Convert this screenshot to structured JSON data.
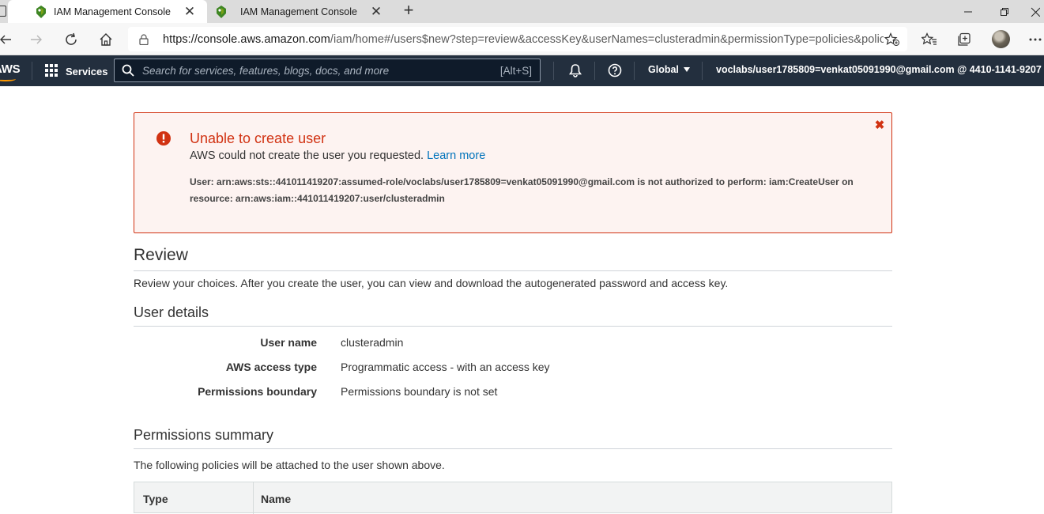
{
  "browser": {
    "tabs": [
      {
        "title": "IAM Management Console",
        "active": true
      },
      {
        "title": "IAM Management Console",
        "active": false
      }
    ],
    "url_host": "https://console.aws.amazon.com",
    "url_path": "/iam/home#/users$new?step=review&accessKey&userNames=clusteradmin&permissionType=policies&policie..."
  },
  "aws_nav": {
    "logo": "AWS",
    "services_label": "Services",
    "search_placeholder": "Search for services, features, blogs, docs, and more",
    "search_shortcut": "[Alt+S]",
    "region": "Global",
    "account": "voclabs/user1785809=venkat05091990@gmail.com @ 4410-1141-9207"
  },
  "error": {
    "title": "Unable to create user",
    "description": "AWS could not create the user you requested.",
    "learn_more": "Learn more",
    "detail_line1": "User: arn:aws:sts::441011419207:assumed-role/voclabs/user1785809=venkat05091990@gmail.com is not authorized to perform: iam:CreateUser on",
    "detail_line2": "resource: arn:aws:iam::441011419207:user/clusteradmin",
    "colors": {
      "border": "#d13212",
      "background": "#fdf3f1"
    }
  },
  "review": {
    "heading": "Review",
    "intro": "Review your choices. After you create the user, you can view and download the autogenerated password and access key.",
    "user_details_heading": "User details",
    "details": [
      {
        "label": "User name",
        "value": "clusteradmin"
      },
      {
        "label": "AWS access type",
        "value": "Programmatic access - with an access key"
      },
      {
        "label": "Permissions boundary",
        "value": "Permissions boundary is not set"
      }
    ],
    "permissions_heading": "Permissions summary",
    "permissions_intro": "The following policies will be attached to the user shown above.",
    "table_headers": {
      "type": "Type",
      "name": "Name"
    }
  },
  "colors": {
    "aws_nav": "#232f3e",
    "aws_orange": "#ff9900",
    "link": "#0073bb"
  }
}
